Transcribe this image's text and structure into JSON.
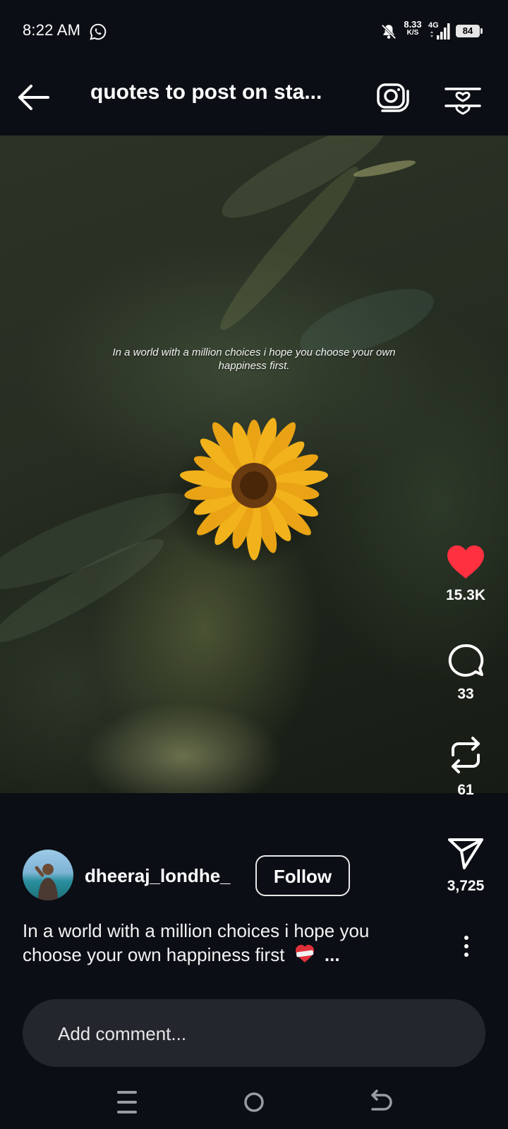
{
  "status_bar": {
    "time": "8:22 AM",
    "net_speed_value": "8.33",
    "net_speed_unit": "K/S",
    "network_type": "4G",
    "battery": "84",
    "icons": [
      "whatsapp-icon",
      "mute-bell-icon",
      "signal-icon",
      "battery-icon"
    ]
  },
  "header": {
    "title": "quotes to post on sta...",
    "icons": [
      "back-arrow-icon",
      "camera-icon",
      "filter-heart-icon"
    ]
  },
  "post": {
    "overlay_text": "In a world with a million choices i hope you choose your own happiness first.",
    "actions": {
      "likes": "15.3K",
      "comments": "33",
      "reposts": "61",
      "shares": "3,725"
    },
    "like_color": "#ff3040",
    "author": {
      "username": "dheeraj_londhe_",
      "follow_label": "Follow"
    },
    "caption_text": "In a world with a million choices i hope you choose your own happiness first",
    "caption_suffix": "...",
    "more_icon": "vertical-dots-icon"
  },
  "comment": {
    "placeholder": "Add comment..."
  },
  "nav_bar": {
    "icons": [
      "recents-icon",
      "home-circle-icon",
      "back-nav-icon"
    ]
  }
}
